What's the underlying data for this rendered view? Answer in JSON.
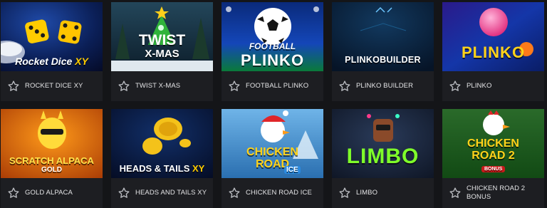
{
  "colors": {
    "background": "#141518",
    "card": "#1d1e22",
    "text": "#e4e4e6",
    "star": "#b9bbc0"
  },
  "games": [
    {
      "name": "ROCKET DICE XY",
      "art_title": "Rocket Dice",
      "art_badge": "XY",
      "icon": "star-outline-icon"
    },
    {
      "name": "TWIST X-MAS",
      "art_title": "TWIST",
      "art_subtitle": "X-MAS",
      "icon": "star-outline-icon"
    },
    {
      "name": "FOOTBALL PLINKO",
      "art_title": "PLINKO",
      "art_subtitle": "FOOTBALL",
      "icon": "star-outline-icon"
    },
    {
      "name": "PLINKO BUILDER",
      "art_title": "PLINKOBUILDER",
      "icon": "star-outline-icon"
    },
    {
      "name": "PLINKO",
      "art_title": "PLINKO",
      "icon": "star-outline-icon"
    },
    {
      "name": "GOLD ALPACA",
      "art_title": "SCRATCH ALPACA",
      "art_subtitle": "GOLD",
      "icon": "star-outline-icon"
    },
    {
      "name": "HEADS AND TAILS XY",
      "art_title": "HEADS & TAILS",
      "art_badge": "XY",
      "icon": "star-outline-icon"
    },
    {
      "name": "CHICKEN ROAD ICE",
      "art_title": "CHICKEN ROAD",
      "art_badge": "ICE",
      "icon": "star-outline-icon"
    },
    {
      "name": "LIMBO",
      "art_title": "LIMBO",
      "icon": "star-outline-icon"
    },
    {
      "name": "CHICKEN ROAD 2 BONUS",
      "name_line1": "CHICKEN ROAD 2",
      "name_line2": "BONUS",
      "art_title": "CHICKEN ROAD 2",
      "art_badge": "BONUS",
      "icon": "star-outline-icon"
    }
  ]
}
